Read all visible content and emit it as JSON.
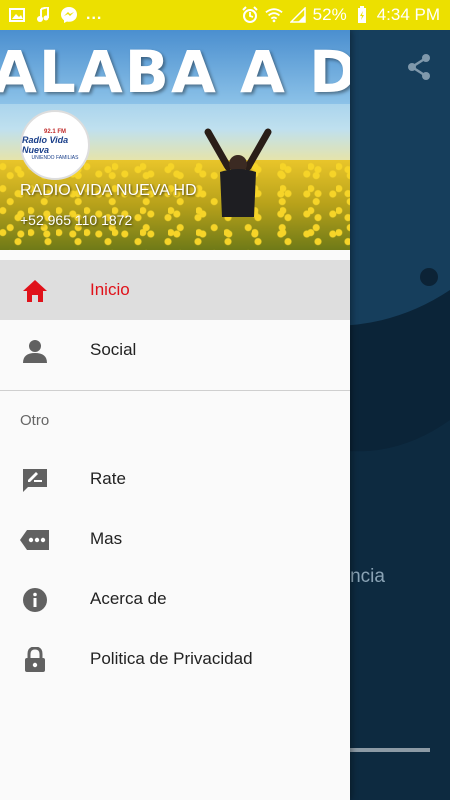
{
  "status_bar": {
    "battery": "52%",
    "time": "4:34 PM",
    "more": "..."
  },
  "background_app": {
    "visible_text": "sencia"
  },
  "drawer": {
    "header": {
      "banner": "ALABA A DIOS",
      "station_name": "RADIO VIDA NUEVA HD",
      "phone": "+52 965 110 1872",
      "logo": {
        "frequency": "92.1 FM",
        "name": "Radio Vida Nueva",
        "tagline": "UNIENDO FAMILIAS"
      }
    },
    "items": [
      {
        "label": "Inicio",
        "icon": "home-icon",
        "active": true
      },
      {
        "label": "Social",
        "icon": "person-icon",
        "active": false
      }
    ],
    "section_label": "Otro",
    "other_items": [
      {
        "label": "Rate",
        "icon": "rate-icon"
      },
      {
        "label": "Mas",
        "icon": "more-tag-icon"
      },
      {
        "label": "Acerca de",
        "icon": "info-icon"
      },
      {
        "label": "Politica de Privacidad",
        "icon": "lock-icon"
      }
    ]
  },
  "colors": {
    "status_bar": "#ece000",
    "accent_active": "#e0121a",
    "drawer_bg": "#fafafa",
    "background_app": "#163e5c"
  }
}
